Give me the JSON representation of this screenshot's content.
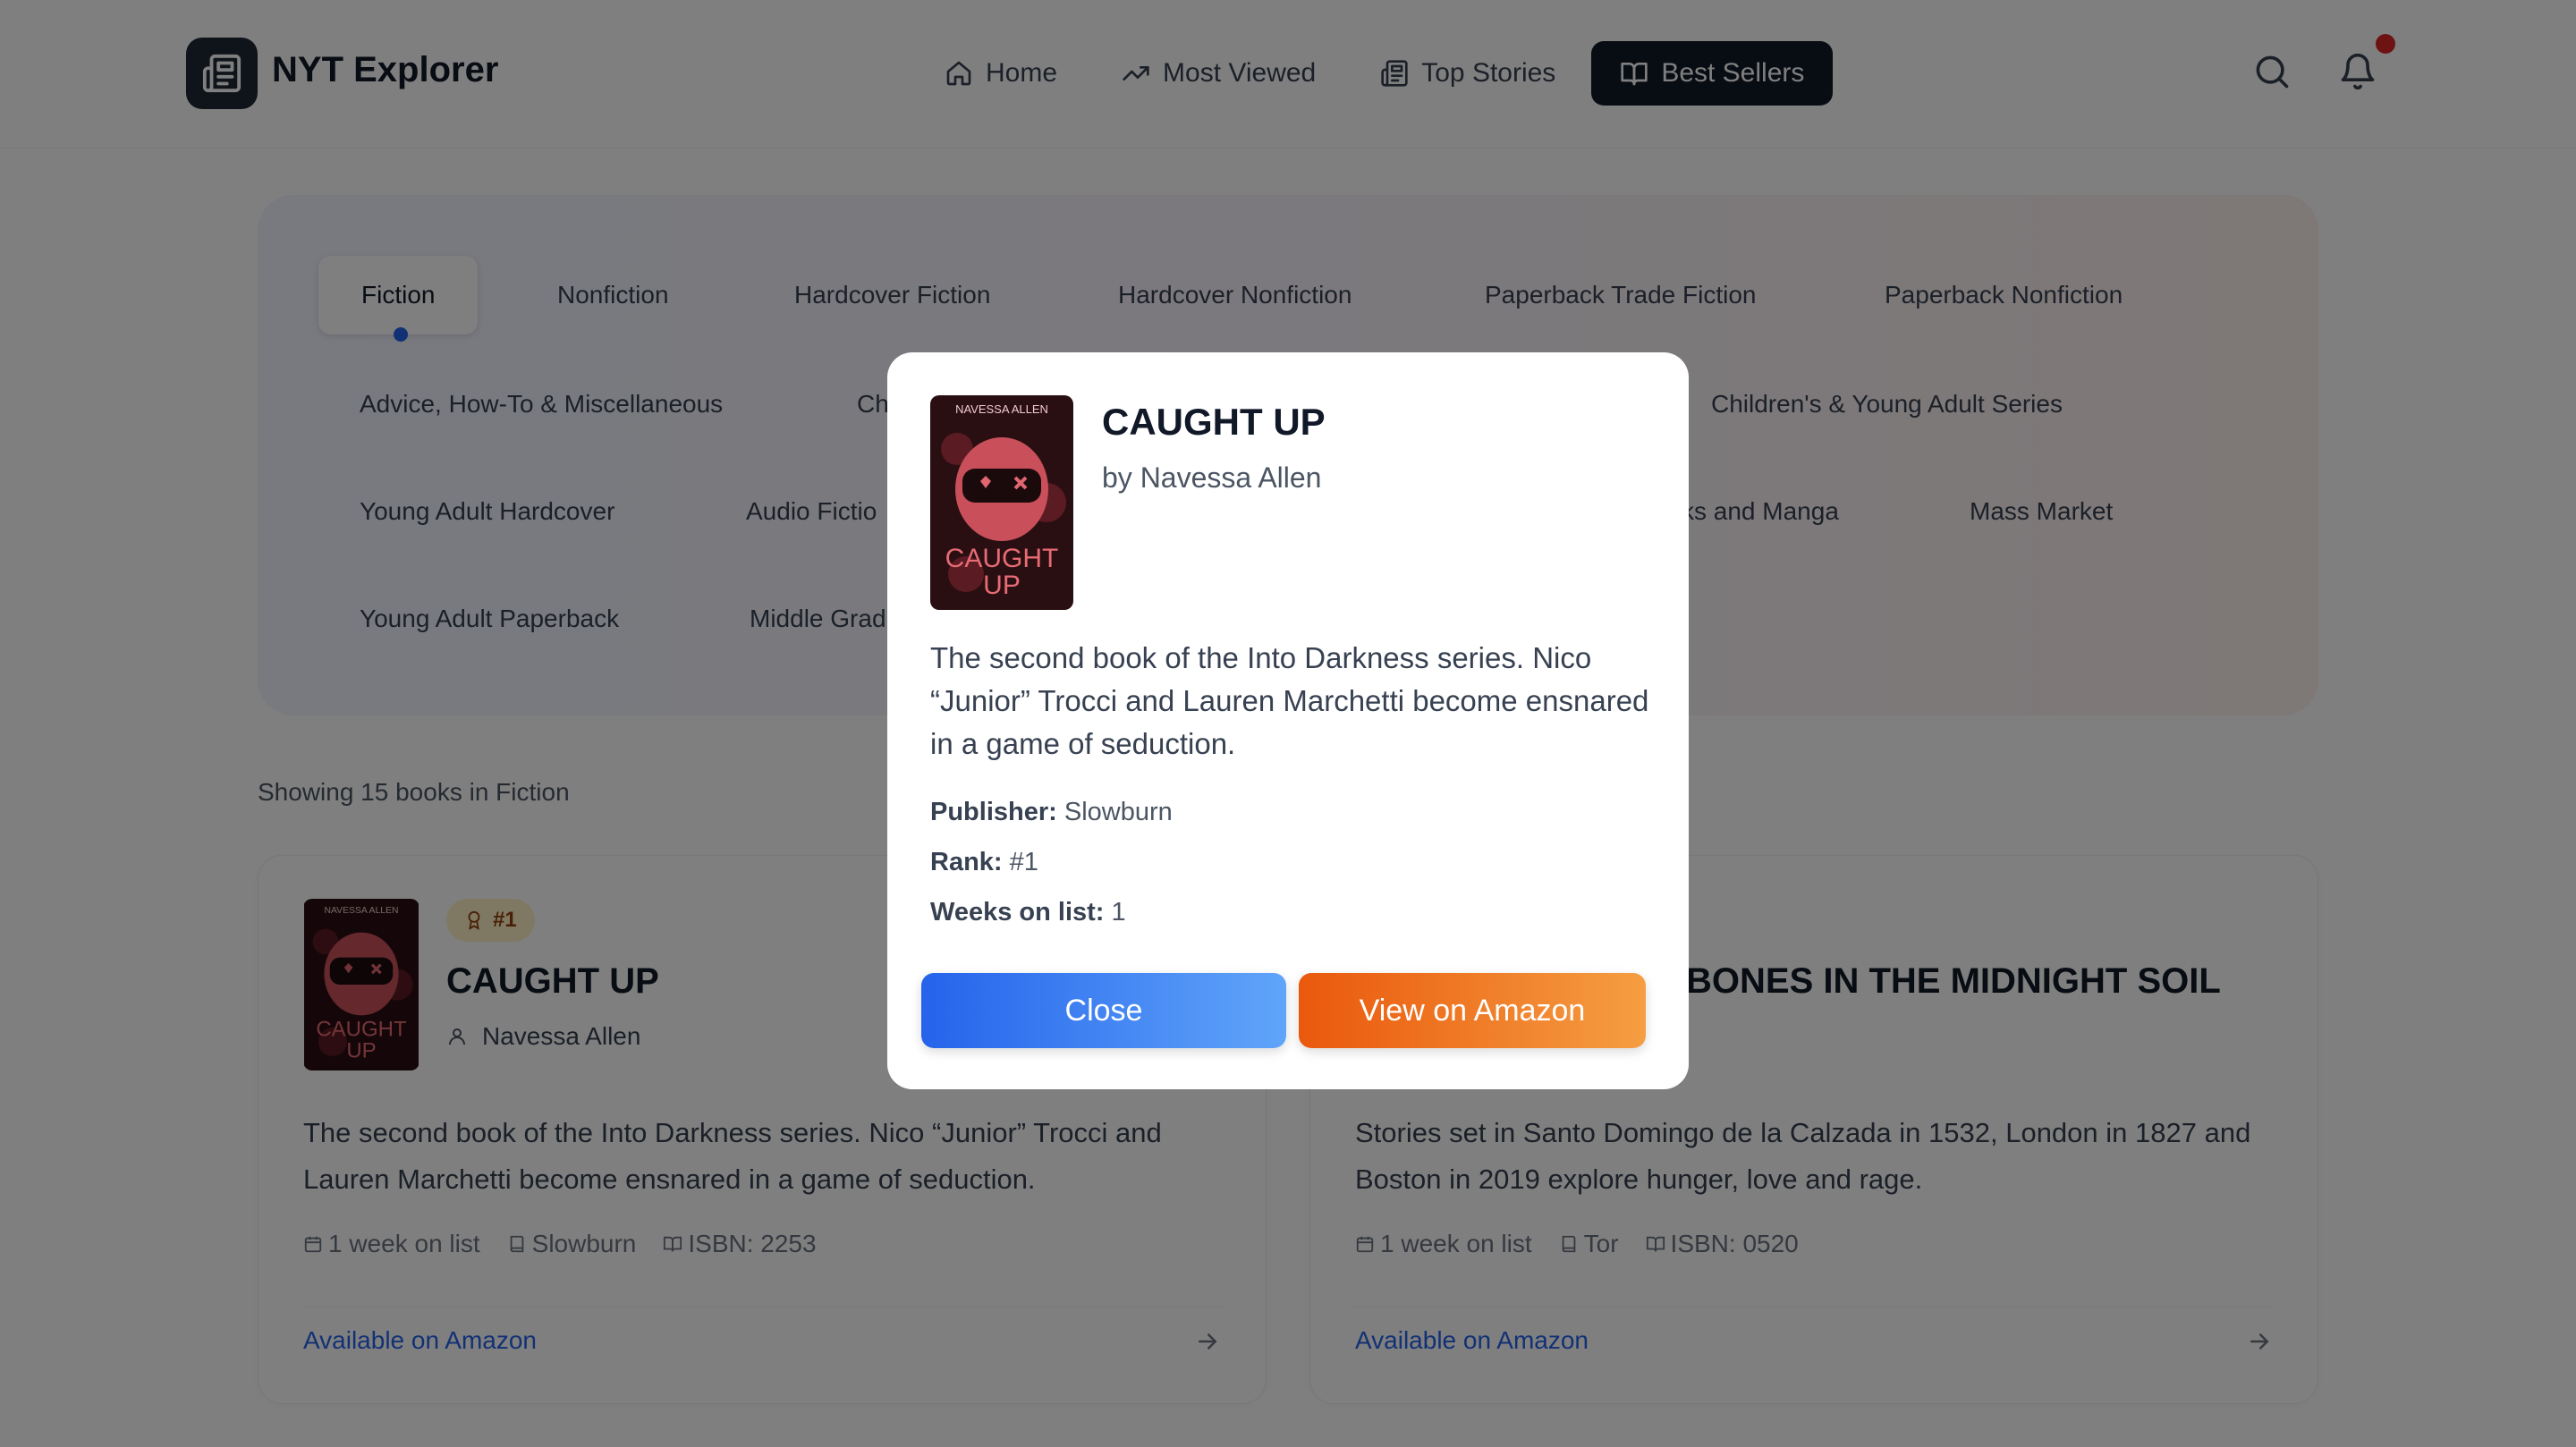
{
  "app": {
    "title": "NYT Explorer"
  },
  "nav": {
    "items": [
      {
        "label": "Home",
        "icon": "home-icon"
      },
      {
        "label": "Most Viewed",
        "icon": "trending-up-icon"
      },
      {
        "label": "Top Stories",
        "icon": "newspaper-icon"
      },
      {
        "label": "Best Sellers",
        "icon": "book-open-icon",
        "active": true
      }
    ]
  },
  "categories": [
    {
      "label": "Fiction",
      "active": true
    },
    {
      "label": "Nonfiction"
    },
    {
      "label": "Hardcover Fiction"
    },
    {
      "label": "Hardcover Nonfiction"
    },
    {
      "label": "Paperback Trade Fiction"
    },
    {
      "label": "Paperback Nonfiction"
    },
    {
      "label": "Advice, How-To & Miscellaneous"
    },
    {
      "label": "Ch"
    },
    {
      "label": "Children's & Young Adult Series"
    },
    {
      "label": "Young Adult Hardcover"
    },
    {
      "label": "Audio Fictio"
    },
    {
      "label": "ks and Manga"
    },
    {
      "label": "Mass Market"
    },
    {
      "label": "Young Adult Paperback"
    },
    {
      "label": "Middle Grad"
    }
  ],
  "showing": "Showing 15 books in Fiction",
  "cards": [
    {
      "rank": "#1",
      "title": "CAUGHT UP",
      "author": "Navessa Allen",
      "description": "The second book of the Into Darkness series. Nico “Junior” Trocci and Lauren Marchetti become ensnared in a game of seduction.",
      "weeks": "1 week on list",
      "publisher": "Slowburn",
      "isbn": "ISBN: 2253",
      "link": "Available on Amazon"
    },
    {
      "title": "BONES IN THE MIDNIGHT SOIL",
      "description": "Stories set in Santo Domingo de la Calzada in 1532, London in 1827 and Boston in 2019 explore hunger, love and rage.",
      "weeks": "1 week on list",
      "publisher": "Tor",
      "isbn": "ISBN: 0520",
      "link": "Available on Amazon"
    }
  ],
  "cover": {
    "author_text": "NAVESSA ALLEN",
    "title_line1": "CAUGHT",
    "title_line2": "UP"
  },
  "modal": {
    "title": "CAUGHT UP",
    "author": "by Navessa Allen",
    "description": "The second book of the Into Darkness series. Nico “Junior” Trocci and Lauren Marchetti become ensnared in a game of seduction.",
    "publisher_label": "Publisher:",
    "publisher": "Slowburn",
    "rank_label": "Rank:",
    "rank": "#1",
    "weeks_label": "Weeks on list:",
    "weeks": "1",
    "close_label": "Close",
    "amazon_label": "View on Amazon"
  },
  "colors": {
    "accent_blue": "#2563eb",
    "accent_orange": "#ea580c",
    "nav_active": "#111827",
    "notification": "#dc2626"
  }
}
